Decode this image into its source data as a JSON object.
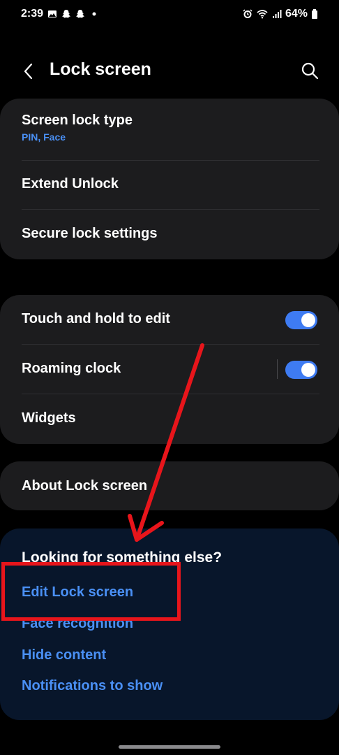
{
  "status_bar": {
    "time": "2:39",
    "battery": "64%",
    "icons_left": [
      "gallery-icon",
      "snapchat-icon",
      "snapchat-icon",
      "dot-icon"
    ],
    "icons_right": [
      "alarm-icon",
      "wifi-icon",
      "signal-icon",
      "battery-icon"
    ]
  },
  "header": {
    "title": "Lock screen"
  },
  "group1": {
    "items": [
      {
        "label": "Screen lock type",
        "sub": "PIN, Face"
      },
      {
        "label": "Extend Unlock"
      },
      {
        "label": "Secure lock settings"
      }
    ]
  },
  "group2": {
    "items": [
      {
        "label": "Touch and hold to edit",
        "toggle": true
      },
      {
        "label": "Roaming clock",
        "toggle": true
      },
      {
        "label": "Widgets"
      }
    ]
  },
  "group3": {
    "items": [
      {
        "label": "About Lock screen"
      }
    ]
  },
  "suggestions": {
    "title": "Looking for something else?",
    "links": [
      "Edit Lock screen",
      "Face recognition",
      "Hide content",
      "Notifications to show"
    ]
  },
  "colors": {
    "accent": "#4a90f5",
    "toggle_on": "#3e7bf2",
    "card_bg": "#1c1c1e",
    "suggest_bg": "#08162b",
    "annotation": "#e8151b"
  }
}
